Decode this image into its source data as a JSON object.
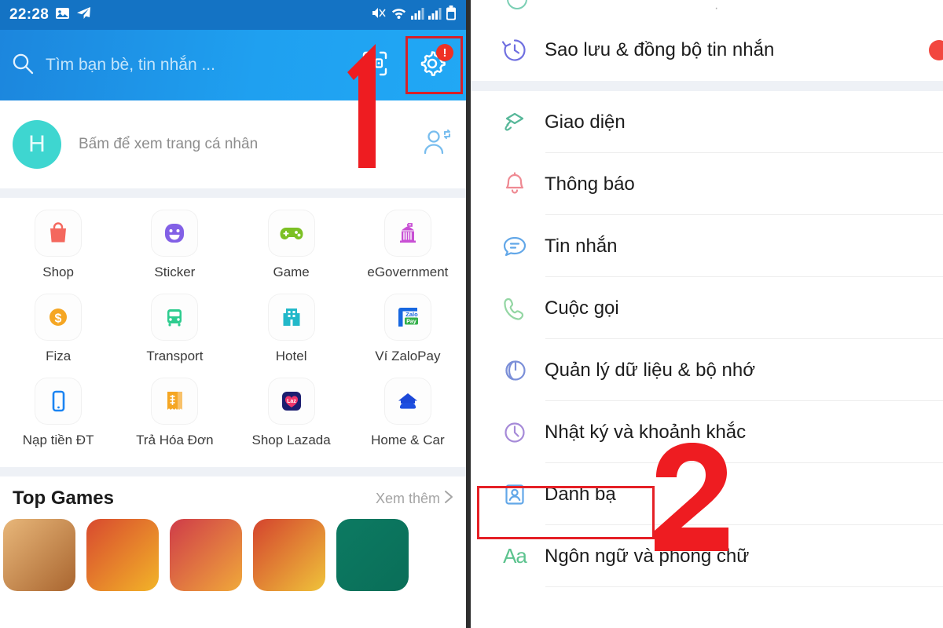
{
  "statusbar": {
    "time": "22:28",
    "icons_left": [
      "image-icon",
      "send-icon"
    ],
    "icons_right": [
      "mute-icon",
      "wifi-icon",
      "signal-icon",
      "signal-icon-2",
      "battery-icon"
    ]
  },
  "search": {
    "placeholder": "Tìm bạn bè, tin nhắn ...",
    "search_icon": "search-icon",
    "qr_icon": "qr-scan-icon",
    "settings_icon": "gear-icon",
    "settings_badge": "!"
  },
  "profile": {
    "avatar_letter": "H",
    "subtitle": "Bấm để xem trang cá nhân",
    "action_icon": "user-sync-icon"
  },
  "apps": [
    {
      "label": "Shop",
      "icon": "shopping-bag-icon",
      "color": "#f4685e"
    },
    {
      "label": "Sticker",
      "icon": "smiley-icon",
      "color": "#8260e6"
    },
    {
      "label": "Game",
      "icon": "gamepad-icon",
      "color": "#7cc024"
    },
    {
      "label": "eGovernment",
      "icon": "government-icon",
      "color": "#c84fd4"
    },
    {
      "label": "Fiza",
      "icon": "coin-dollar-icon",
      "color": "#f5a623"
    },
    {
      "label": "Transport",
      "icon": "bus-icon",
      "color": "#2ecc8f"
    },
    {
      "label": "Hotel",
      "icon": "building-icon",
      "color": "#22b8c9"
    },
    {
      "label": "Ví ZaloPay",
      "icon": "zalopay-icon",
      "color": "#1767e0"
    },
    {
      "label": "Nạp tiền ĐT",
      "icon": "phone-mobile-icon",
      "color": "#1b84f2"
    },
    {
      "label": "Trả Hóa Đơn",
      "icon": "invoice-icon",
      "color": "#f5a623"
    },
    {
      "label": "Shop Lazada",
      "icon": "lazada-icon",
      "color": "#1c1e70"
    },
    {
      "label": "Home & Car",
      "icon": "home-car-icon",
      "color": "#1c48d8"
    }
  ],
  "top_games": {
    "title": "Top Games",
    "more_label": "Xem thêm",
    "more_icon": "chevron-right-icon",
    "thumbs": [
      "#c98d55",
      "#d8492f",
      "#cf3b49",
      "#d4432e",
      "#0c7a62"
    ]
  },
  "settings_menu": [
    {
      "label": "Sao lưu & đồng bộ tin nhắn",
      "icon": "history-restore-icon",
      "color": "#6f6fe0",
      "badge": true
    },
    {
      "label": "Giao diện",
      "icon": "paint-roller-icon",
      "color": "#58b89a",
      "badge": false
    },
    {
      "label": "Thông báo",
      "icon": "bell-icon",
      "color": "#ef8a93",
      "badge": false
    },
    {
      "label": "Tin nhắn",
      "icon": "chat-bubble-icon",
      "color": "#62a7e8",
      "badge": false
    },
    {
      "label": "Cuộc gọi",
      "icon": "phone-call-icon",
      "color": "#93d6a3",
      "badge": false
    },
    {
      "label": "Quản lý dữ liệu & bộ nhớ",
      "icon": "pie-chart-icon",
      "color": "#7b8fd8",
      "badge": false
    },
    {
      "label": "Nhật ký và khoảnh khắc",
      "icon": "clock-icon",
      "color": "#a68ad8",
      "badge": false
    },
    {
      "label": "Danh bạ",
      "icon": "contact-card-icon",
      "color": "#62a7e8",
      "badge": false
    },
    {
      "label": "Ngôn ngữ và phông chữ",
      "icon": "font-size-icon",
      "color": "#5cc38e",
      "badge": false
    }
  ],
  "markers": {
    "step_one": "1",
    "step_two": "2",
    "highlight_color": "#e52026"
  }
}
